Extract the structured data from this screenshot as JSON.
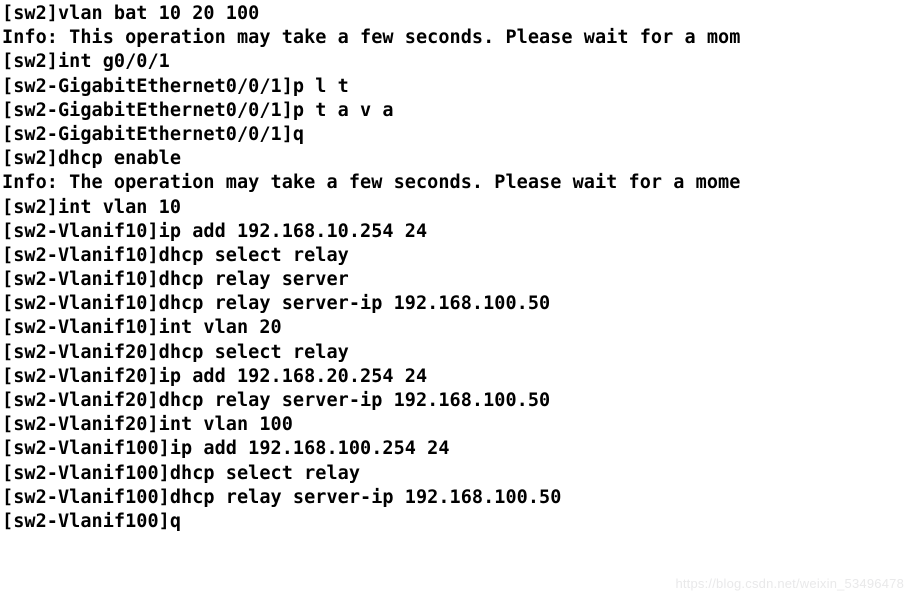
{
  "terminal": {
    "device_prompt_base": "sw2",
    "background_color": "#ffffff",
    "text_color": "#000000",
    "lines": [
      "[sw2]vlan bat 10 20 100",
      "Info: This operation may take a few seconds. Please wait for a mom",
      "[sw2]int g0/0/1",
      "[sw2-GigabitEthernet0/0/1]p l t",
      "[sw2-GigabitEthernet0/0/1]p t a v a",
      "[sw2-GigabitEthernet0/0/1]q",
      "[sw2]dhcp enable",
      "Info: The operation may take a few seconds. Please wait for a mome",
      "[sw2]int vlan 10",
      "[sw2-Vlanif10]ip add 192.168.10.254 24",
      "[sw2-Vlanif10]dhcp select relay",
      "[sw2-Vlanif10]dhcp relay server",
      "[sw2-Vlanif10]dhcp relay server-ip 192.168.100.50",
      "[sw2-Vlanif10]int vlan 20",
      "[sw2-Vlanif20]dhcp select relay",
      "[sw2-Vlanif20]ip add 192.168.20.254 24",
      "[sw2-Vlanif20]dhcp relay server-ip 192.168.100.50",
      "[sw2-Vlanif20]int vlan 100",
      "[sw2-Vlanif100]ip add 192.168.100.254 24",
      "[sw2-Vlanif100]dhcp select relay",
      "[sw2-Vlanif100]dhcp relay server-ip 192.168.100.50",
      "[sw2-Vlanif100]q"
    ]
  },
  "watermark": {
    "text": "https://blog.csdn.net/weixin_53496478",
    "color": "#e9e9ea"
  }
}
